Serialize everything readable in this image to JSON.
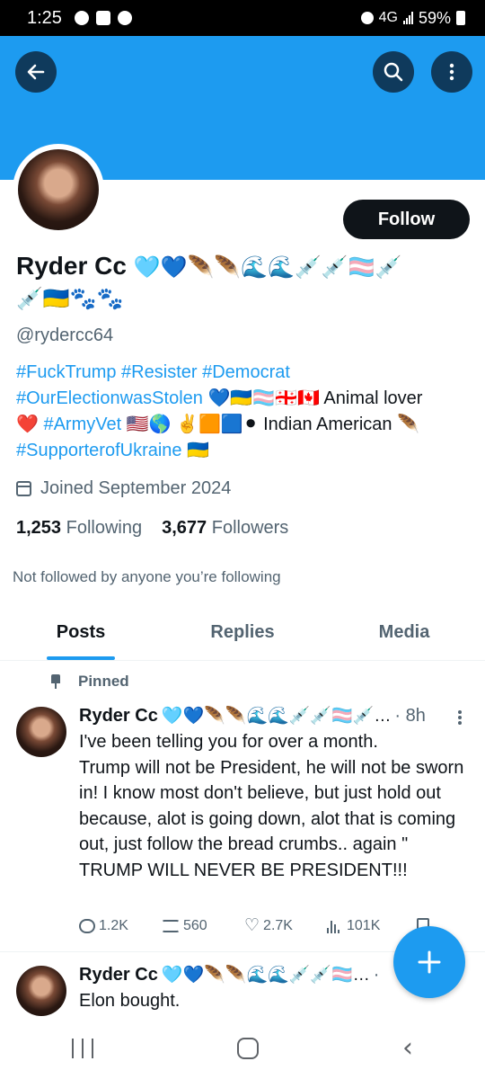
{
  "status_bar": {
    "time": "1:25",
    "network": "4G",
    "battery": "59%"
  },
  "profile": {
    "name": "Ryder Cc",
    "name_emojis": "🩵💙🪶🪶🌊🌊💉💉🏳️‍⚧️💉",
    "name_emojis_line2": "💉🇺🇦🐾🐾",
    "handle": "@rydercc64",
    "follow_label": "Follow",
    "bio": {
      "line1_tags": "#FuckTrump #Resister #Democrat",
      "line2_tag": "#OurElectionwasStolen",
      "line2_rest": " 💙🇺🇦🏳️‍⚧️🇬🇪🇨🇦 Animal lover",
      "line3_emoji": "❤️ ",
      "line3_tag": "#ArmyVet",
      "line3_rest": " 🇺🇸🌎 ✌️🟧🟦⚫ Indian American 🪶",
      "line4_tag": "#SupporterofUkraine",
      "line4_rest": " 🇺🇦"
    },
    "joined": "Joined September 2024",
    "following_count": "1,253",
    "following_label": "Following",
    "followers_count": "3,677",
    "followers_label": "Followers",
    "not_followed": "Not followed by anyone you’re following"
  },
  "tabs": {
    "posts": "Posts",
    "replies": "Replies",
    "media": "Media"
  },
  "tweets": [
    {
      "pinned_label": "Pinned",
      "author": "Ryder Cc",
      "emojis": "🩵💙🪶🪶🌊🌊💉💉🏳️‍⚧️💉…",
      "time": "· 8h",
      "text": "I've been telling you for over a month.\nTrump will not be President,  he will not  be sworn in! I know most don't believe,  but just hold out because, alot is going down, alot that is coming out,  just follow the bread crumbs.. again \" TRUMP WILL NEVER BE PRESIDENT!!!",
      "replies": "1.2K",
      "retweets": "560",
      "likes": "2.7K",
      "views": "101K"
    },
    {
      "author": "Ryder Cc",
      "emojis": "🩵💙🪶🪶🌊🌊💉💉🏳️‍⚧️…",
      "time": "· ",
      "text": "Elon bought."
    }
  ],
  "colors": {
    "accent": "#1d9bf0",
    "banner": "#1d9bf0",
    "text": "#0f1419",
    "secondary": "#536471"
  },
  "icons": [
    "back-arrow-icon",
    "search-icon",
    "more-vertical-icon",
    "calendar-icon",
    "pin-icon",
    "reply-icon",
    "retweet-icon",
    "like-icon",
    "views-icon",
    "bookmark-icon",
    "share-icon",
    "plus-icon"
  ]
}
